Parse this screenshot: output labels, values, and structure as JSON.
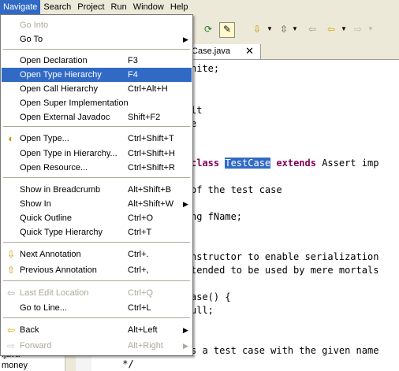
{
  "menubar": [
    "Navigate",
    "Search",
    "Project",
    "Run",
    "Window",
    "Help"
  ],
  "tab": {
    "label": "tCase.java"
  },
  "tree": [
    ".java",
    "money"
  ],
  "code": [
    {
      "t": "nite;",
      "cls": ""
    },
    {
      "t": "lt",
      "cls": "cm"
    },
    {
      "t": "e",
      "cls": "cm"
    },
    {
      "t": "of the test case",
      "cls": "cm"
    },
    {
      "t": "ng fName;",
      "cls": ""
    },
    {
      "t": "nstructor to enable serialization",
      "cls": "cm"
    },
    {
      "t": "tended to be used by mere mortals",
      "cls": "cm"
    },
    {
      "t": "ase() {",
      "cls": ""
    },
    {
      "t": "ull;",
      "cls": "kw"
    },
    {
      "t": "s a test case with the given name",
      "cls": "cm"
    },
    {
      "t": " */",
      "cls": "cm"
    }
  ],
  "class_line": {
    "kw1": "class",
    "name": "TestCase",
    "kw2": "extends",
    "rest": "Assert imp"
  },
  "menu": {
    "items": [
      {
        "label": "Go Into",
        "acc": "",
        "disabled": true
      },
      {
        "label": "Go To",
        "acc": "",
        "submenu": true
      },
      {
        "label": "Open Declaration",
        "acc": "F3"
      },
      {
        "label": "Open Type Hierarchy",
        "acc": "F4",
        "highlight": true
      },
      {
        "label": "Open Call Hierarchy",
        "acc": "Ctrl+Alt+H"
      },
      {
        "label": "Open Super Implementation",
        "acc": ""
      },
      {
        "label": "Open External Javadoc",
        "acc": "Shift+F2"
      },
      {
        "label": "Open Type...",
        "acc": "Ctrl+Shift+T",
        "icon": "open-type-icon"
      },
      {
        "label": "Open Type in Hierarchy...",
        "acc": "Ctrl+Shift+H"
      },
      {
        "label": "Open Resource...",
        "acc": "Ctrl+Shift+R"
      },
      {
        "label": "Show in Breadcrumb",
        "acc": "Alt+Shift+B"
      },
      {
        "label": "Show In",
        "acc": "Alt+Shift+W",
        "submenu": true
      },
      {
        "label": "Quick Outline",
        "acc": "Ctrl+O"
      },
      {
        "label": "Quick Type Hierarchy",
        "acc": "Ctrl+T"
      },
      {
        "label": "Next Annotation",
        "acc": "Ctrl+.",
        "icon": "next-annotation-icon"
      },
      {
        "label": "Previous Annotation",
        "acc": "Ctrl+,",
        "icon": "previous-annotation-icon"
      },
      {
        "label": "Last Edit Location",
        "acc": "Ctrl+Q",
        "disabled": true,
        "icon": "last-edit-icon"
      },
      {
        "label": "Go to Line...",
        "acc": "Ctrl+L"
      },
      {
        "label": "Back",
        "acc": "Alt+Left",
        "submenu": true,
        "icon": "back-arrow-icon"
      },
      {
        "label": "Forward",
        "acc": "Alt+Right",
        "submenu": true,
        "disabled": true,
        "icon": "forward-arrow-icon"
      }
    ]
  },
  "colors": {
    "highlight": "#316ac5",
    "chrome": "#ece9d8",
    "keyword": "#7f0055",
    "comment": "#3f5fbf"
  }
}
